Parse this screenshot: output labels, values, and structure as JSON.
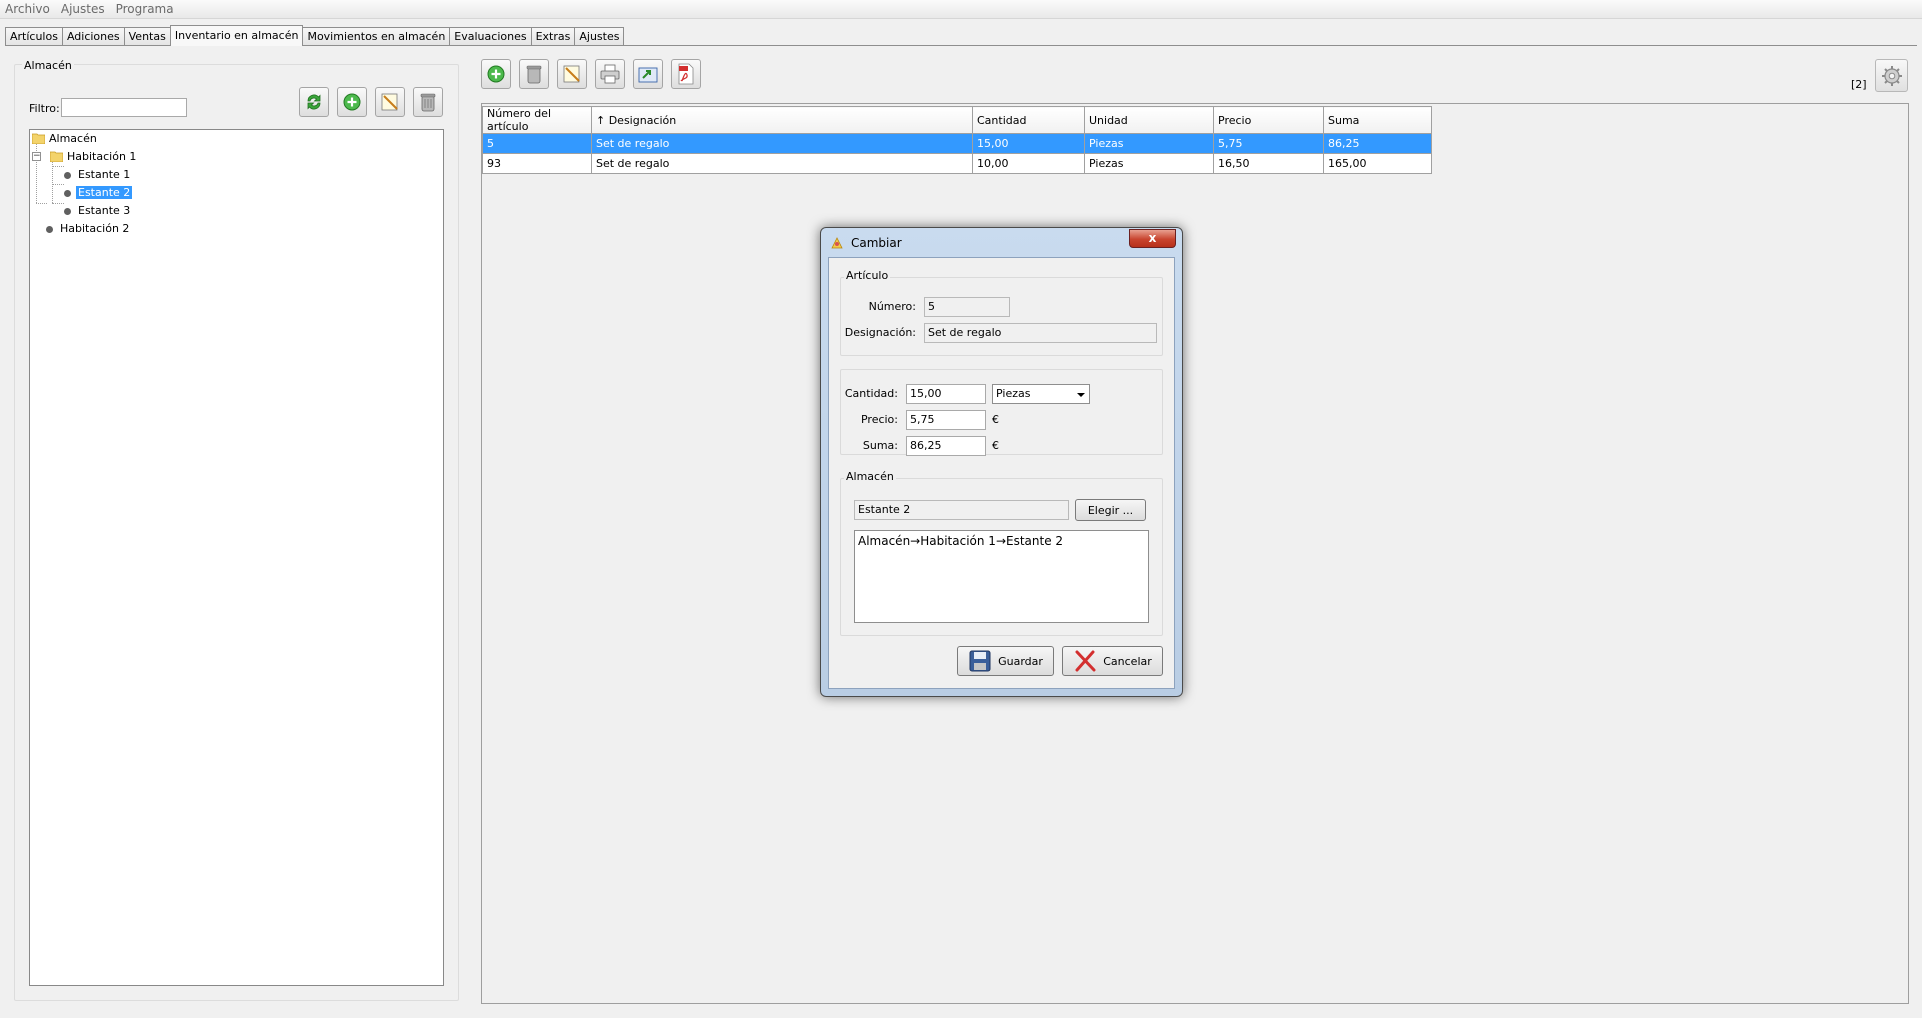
{
  "menu": [
    "Archivo",
    "Ajustes",
    "Programa"
  ],
  "tabs": [
    "Artículos",
    "Adiciones",
    "Ventas",
    "Inventario en almacén",
    "Movimientos en almacén",
    "Evaluaciones",
    "Extras",
    "Ajustes"
  ],
  "active_tab": "Inventario en almacén",
  "left": {
    "title": "Almacén",
    "filter_label": "Filtro:",
    "filter_value": "",
    "tree": {
      "root": "Almacén",
      "room1": "Habitación 1",
      "shelf1": "Estante 1",
      "shelf2": "Estante 2",
      "shelf3": "Estante 3",
      "room2": "Habitación 2"
    },
    "selected": "Estante 2"
  },
  "right": {
    "counter": "[2]",
    "columns": [
      "Número del artículo",
      "↑ Designación",
      "Cantidad",
      "Unidad",
      "Precio",
      "Suma"
    ],
    "rows": [
      [
        "5",
        "Set de regalo",
        "15,00",
        "Piezas",
        "5,75",
        "86,25"
      ],
      [
        "93",
        "Set de regalo",
        "10,00",
        "Piezas",
        "16,50",
        "165,00"
      ]
    ]
  },
  "dialog": {
    "title": "Cambiar",
    "close": "x",
    "article_group": "Artículo",
    "number_label": "Número:",
    "number_value": "5",
    "designation_label": "Designación:",
    "designation_value": "Set de regalo",
    "quantity_label": "Cantidad:",
    "quantity_value": "15,00",
    "unit_value": "Piezas",
    "price_label": "Precio:",
    "price_value": "5,75",
    "sum_label": "Suma:",
    "sum_value": "86,25",
    "currency": "€",
    "store_group": "Almacén",
    "store_value": "Estante 2",
    "choose_label": "Elegir ...",
    "path": "Almacén→Habitación 1→Estante 2",
    "save_label": "Guardar",
    "cancel_label": "Cancelar"
  },
  "colors": {
    "selection": "#3399ff",
    "accent": "#2a8a2a"
  }
}
